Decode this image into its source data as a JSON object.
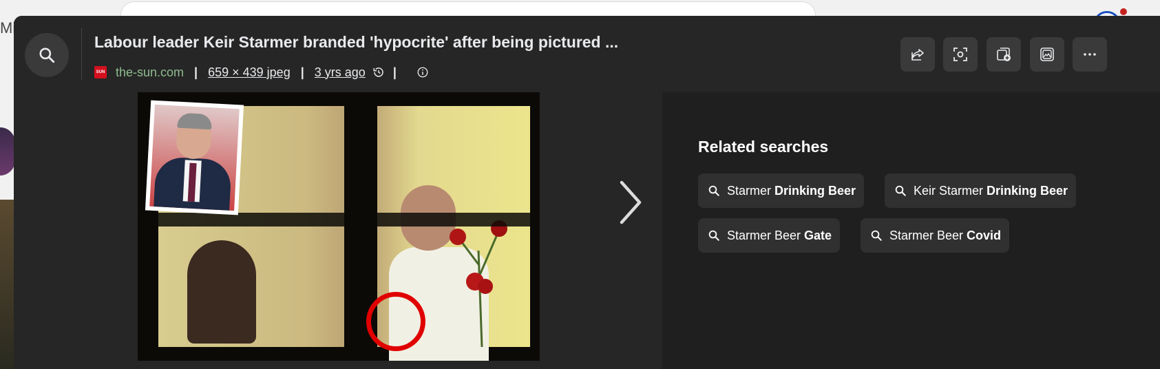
{
  "background": {
    "partial_text": "Mi"
  },
  "header": {
    "title": "Labour leader Keir Starmer branded 'hypocrite' after being pictured ...",
    "source": "the-sun.com",
    "source_logo_text": "SUN",
    "separator": "|",
    "dimensions": "659 × 439 jpeg",
    "age": "3 yrs ago"
  },
  "icons": {
    "search": "search-icon",
    "share": "share-icon",
    "visual_search": "lens-icon",
    "add_collection": "add-collection-icon",
    "image_details": "image-icon",
    "more": "more-icon",
    "history": "history-icon",
    "info": "info-icon",
    "next": "chevron-right-icon"
  },
  "related": {
    "title": "Related searches",
    "chips": [
      {
        "plain": "Starmer ",
        "bold": "Drinking Beer"
      },
      {
        "plain": "Keir Starmer ",
        "bold": "Drinking Beer"
      },
      {
        "plain": "Starmer Beer ",
        "bold": "Gate"
      },
      {
        "plain": "Starmer Beer ",
        "bold": "Covid"
      }
    ]
  },
  "colors": {
    "overlay_bg": "#1f1f1f",
    "header_bg": "#262626",
    "source_green": "#8fbc8f",
    "chip_bg": "#303030",
    "annotation_red": "#e00000"
  }
}
